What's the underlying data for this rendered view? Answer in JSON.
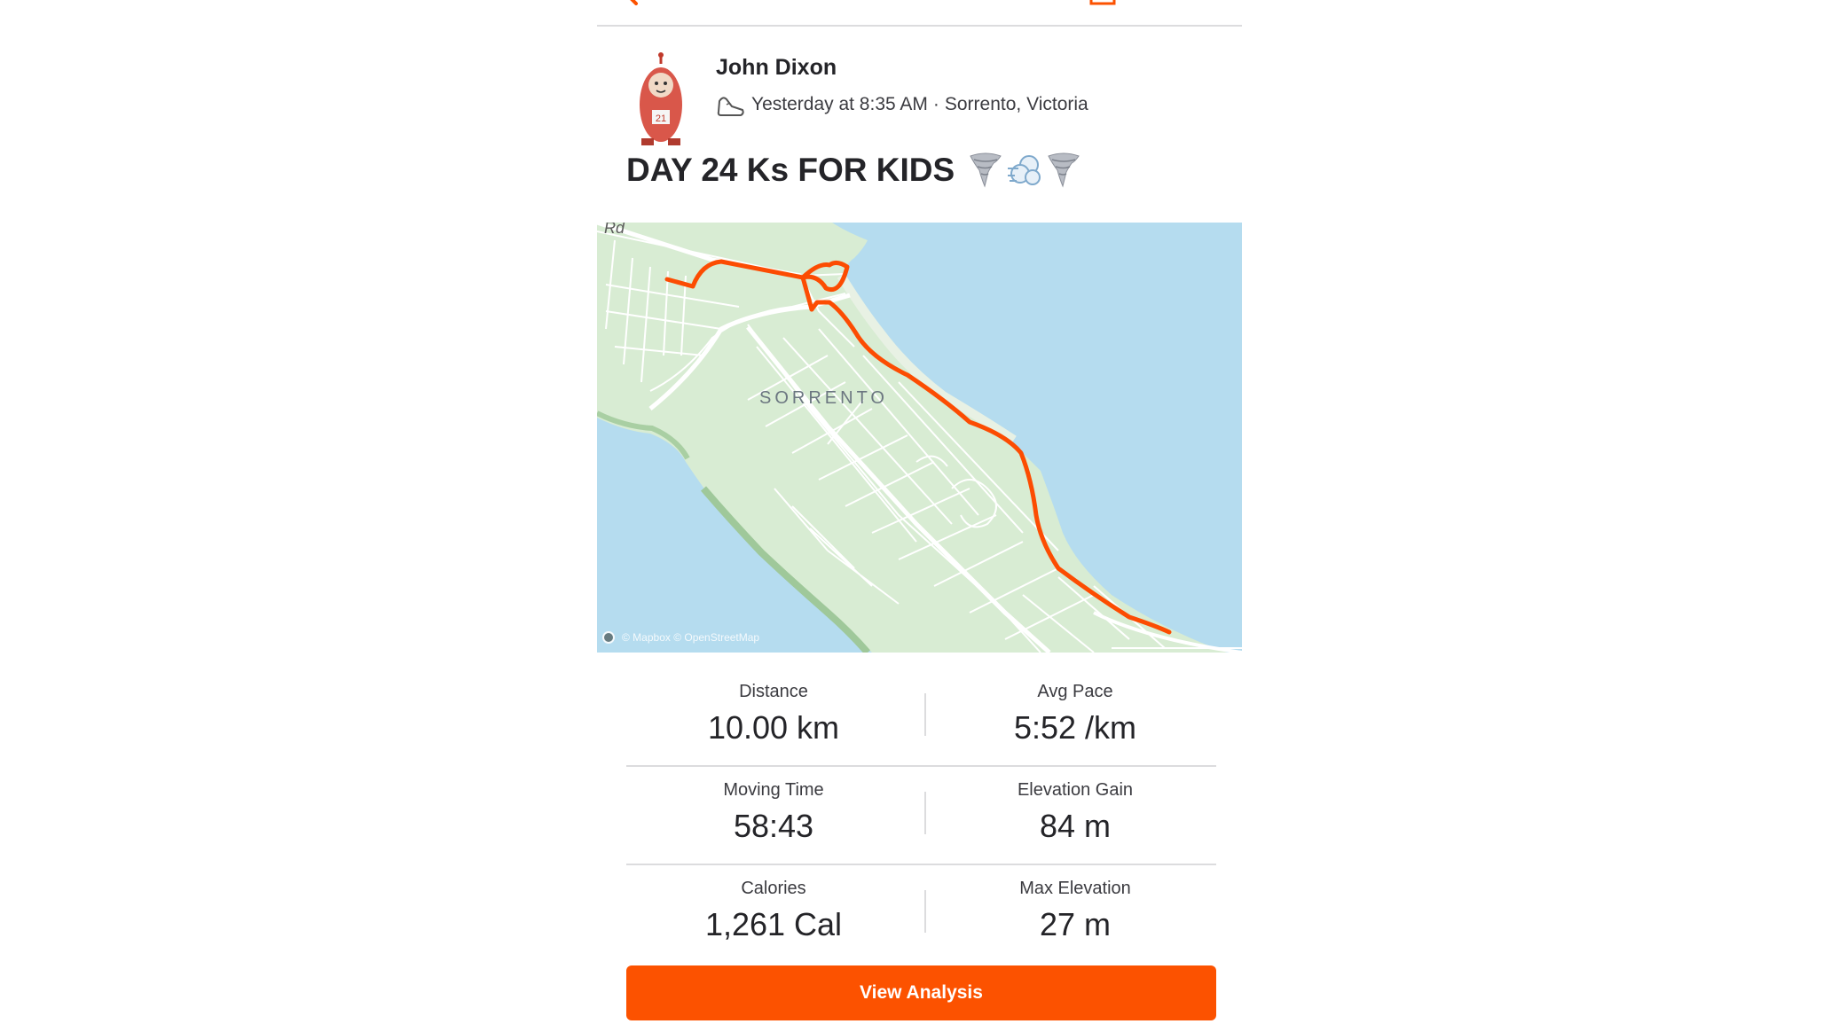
{
  "colors": {
    "accent": "#fc5200",
    "route": "#fc4c02",
    "water": "#b5dcef",
    "land": "#d8ecd3",
    "text": "#242428"
  },
  "topbar": {
    "back_icon": "chevron-left-icon",
    "share_icon": "share-icon"
  },
  "activity": {
    "athlete_name": "John Dixon",
    "activity_icon": "shoe-icon",
    "time": "Yesterday at 8:35 AM",
    "separator": "·",
    "location": "Sorrento, Victoria",
    "title": "DAY 24 Ks FOR KIDS",
    "title_emojis": [
      "tornado-emoji",
      "wind-emoji",
      "tornado-emoji"
    ]
  },
  "map": {
    "place_label": "SORRENTO",
    "road_label": "Rd",
    "attribution": "© Mapbox © OpenStreetMap"
  },
  "stats": [
    {
      "left_label": "Distance",
      "left_value": "10.00 km",
      "right_label": "Avg Pace",
      "right_value": "5:52 /km"
    },
    {
      "left_label": "Moving Time",
      "left_value": "58:43",
      "right_label": "Elevation Gain",
      "right_value": "84 m"
    },
    {
      "left_label": "Calories",
      "left_value": "1,261 Cal",
      "right_label": "Max Elevation",
      "right_value": "27 m"
    }
  ],
  "actions": {
    "view_analysis": "View Analysis"
  }
}
